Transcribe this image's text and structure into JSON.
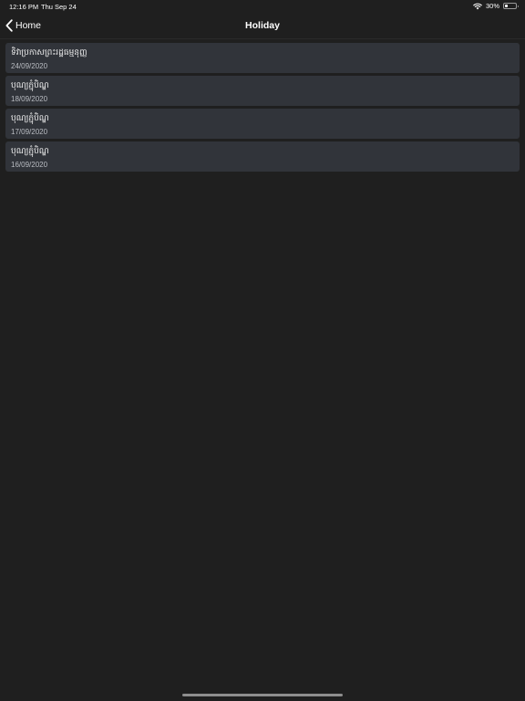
{
  "status_bar": {
    "time": "12:16 PM",
    "date": "Thu Sep 24",
    "battery": "30%",
    "battery_level": 0.3,
    "wifi_icon": "wifi-icon",
    "battery_icon": "battery-icon"
  },
  "nav": {
    "back_label": "Home",
    "back_icon": "chevron-left-icon",
    "title": "Holiday"
  },
  "holidays": [
    {
      "name": "ទិវាប្រកាសព្រះរដ្ឋធម្មនុញ្ញ",
      "date": "24/09/2020"
    },
    {
      "name": "បុណ្យភ្ជុំបិណ្ឌ",
      "date": "18/09/2020"
    },
    {
      "name": "បុណ្យភ្ជុំបិណ្ឌ",
      "date": "17/09/2020"
    },
    {
      "name": "បុណ្យភ្ជុំបិណ្ឌ",
      "date": "16/09/2020"
    }
  ],
  "colors": {
    "background": "#1f1f1f",
    "card": "#31343a",
    "secondary_text": "#b9bcc2"
  }
}
